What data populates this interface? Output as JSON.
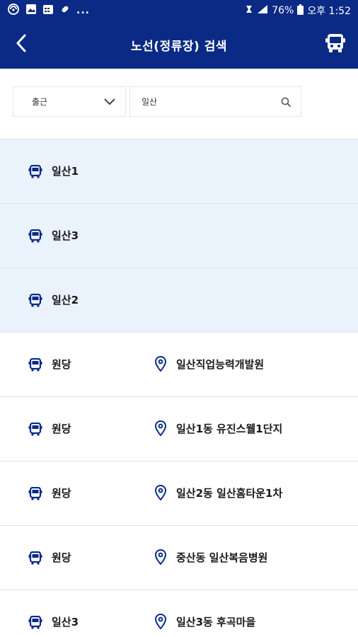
{
  "status_bar": {
    "left_icons": [
      "signal-app-icon",
      "image-icon",
      "calendar-icon",
      "pill-icon"
    ],
    "more": "...",
    "battery_percent": "76%",
    "time": "오후 1:52"
  },
  "header": {
    "title": "노선(정류장) 검색",
    "back_icon": "chevron-left-icon",
    "action_icon": "bus-icon"
  },
  "search": {
    "direction_selected": "출근",
    "query": "일산",
    "search_icon": "search-icon"
  },
  "colors": {
    "header_bg": "#0b2a86",
    "highlight_bg": "#eaf2fc",
    "icon_color": "#0b2a86"
  },
  "results": [
    {
      "route": "일산1",
      "stop": "",
      "highlighted": true
    },
    {
      "route": "일산3",
      "stop": "",
      "highlighted": true
    },
    {
      "route": "일산2",
      "stop": "",
      "highlighted": true
    },
    {
      "route": "원당",
      "stop": "일산직업능력개발원",
      "highlighted": false
    },
    {
      "route": "원당",
      "stop": "일산1동 유진스웰1단지",
      "highlighted": false
    },
    {
      "route": "원당",
      "stop": "일산2동 일산홈타운1차",
      "highlighted": false
    },
    {
      "route": "원당",
      "stop": "중산동 일산복음병원",
      "highlighted": false
    },
    {
      "route": "일산3",
      "stop": "일산3동 후곡마을",
      "highlighted": false
    }
  ]
}
